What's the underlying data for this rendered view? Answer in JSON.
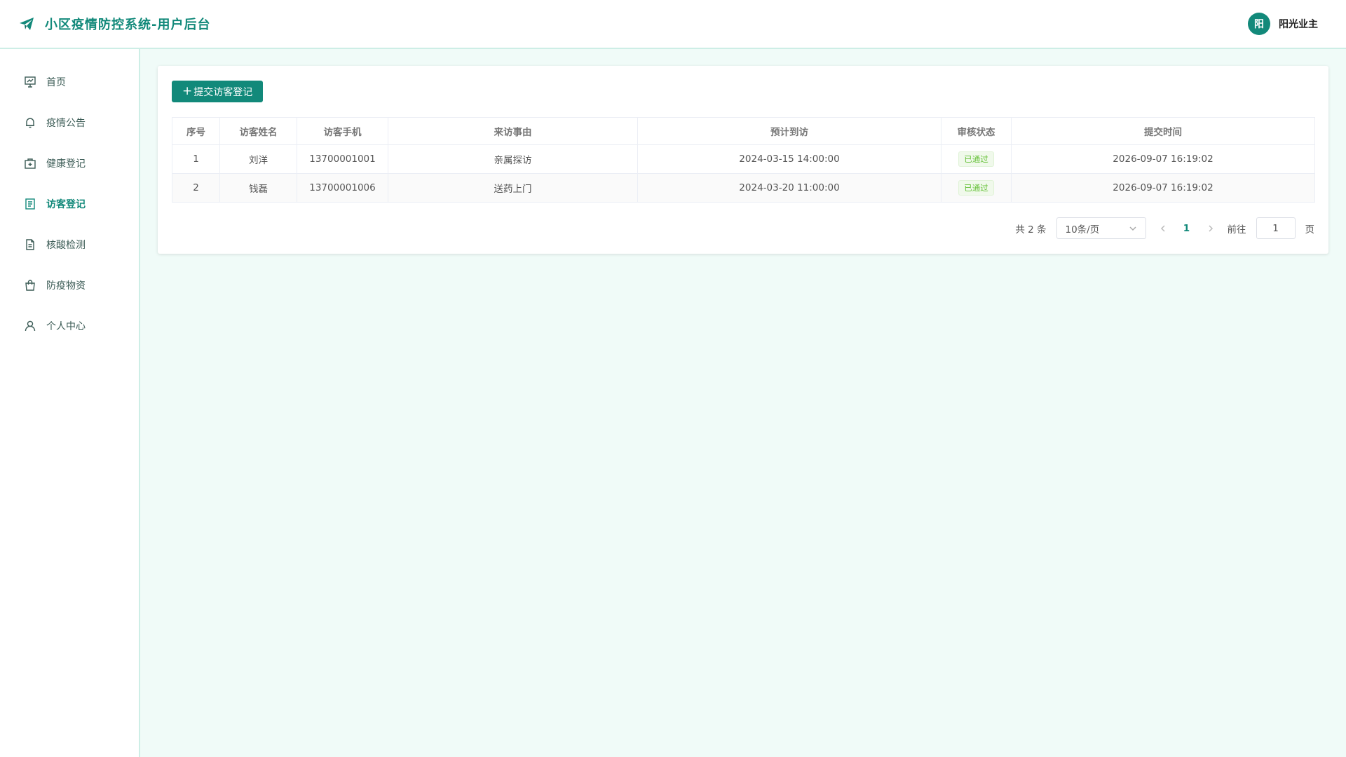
{
  "header": {
    "brand_title": "小区疫情防控系统-用户后台",
    "avatar_text": "阳",
    "user_name": "阳光业主"
  },
  "sidebar": {
    "items": [
      {
        "label": "首页",
        "icon": "presentation-icon",
        "active": false
      },
      {
        "label": "疫情公告",
        "icon": "bell-icon",
        "active": false
      },
      {
        "label": "健康登记",
        "icon": "medical-kit-icon",
        "active": false
      },
      {
        "label": "访客登记",
        "icon": "notes-icon",
        "active": true
      },
      {
        "label": "核酸检测",
        "icon": "document-icon",
        "active": false
      },
      {
        "label": "防疫物资",
        "icon": "shopping-bag-icon",
        "active": false
      },
      {
        "label": "个人中心",
        "icon": "user-icon",
        "active": false
      }
    ]
  },
  "main": {
    "submit_button": "提交访客登记",
    "table": {
      "columns": [
        "序号",
        "访客姓名",
        "访客手机",
        "来访事由",
        "预计到访",
        "审核状态",
        "提交时间"
      ],
      "rows": [
        [
          "1",
          "刘洋",
          "13700001001",
          "亲属探访",
          "2024-03-15 14:00:00",
          "已通过",
          "2026-09-07 16:19:02"
        ],
        [
          "2",
          "钱磊",
          "13700001006",
          "送药上门",
          "2024-03-20 11:00:00",
          "已通过",
          "2026-09-07 16:19:02"
        ]
      ]
    },
    "pagination": {
      "total": "共 2 条",
      "page_size": "10条/页",
      "current_page": "1",
      "goto_label": "前往",
      "goto_value": "1",
      "page_unit": "页"
    }
  },
  "colors": {
    "accent": "#12897a",
    "success": "#67c23a",
    "background": "#f0fbf8"
  }
}
